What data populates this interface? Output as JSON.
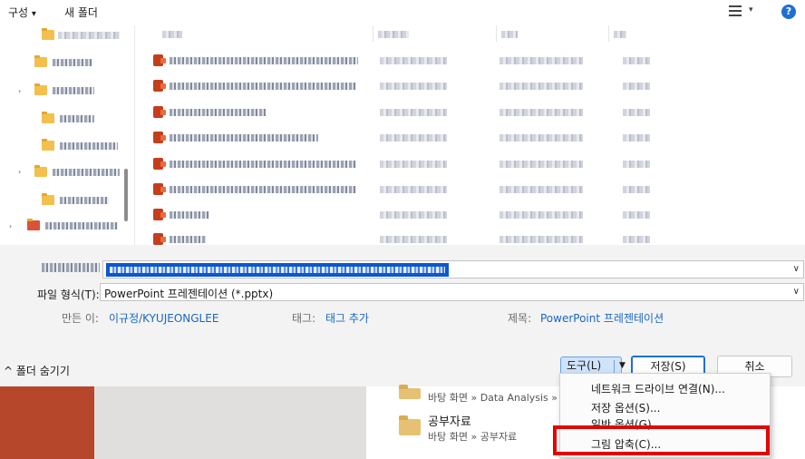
{
  "toolbar": {
    "organize_label": "구성",
    "organize_caret": "▾",
    "new_folder_label": "새 폴더",
    "view_caret": "▾",
    "help_label": "?"
  },
  "file_type": {
    "label": "파일 형식(T):",
    "value": "PowerPoint 프레젠테이션 (*.pptx)",
    "caret": "∨"
  },
  "filename": {
    "caret": "∨"
  },
  "meta": {
    "author_label": "만든 이:",
    "author_value": "이규정/KYUJEONGLEE",
    "tags_label": "태그:",
    "tags_value": "태그 추가",
    "title_label": "제목:",
    "title_value": "PowerPoint 프레젠테이션"
  },
  "bottom": {
    "hide_folders_label": "^  폴더 숨기기",
    "tools_label": "도구(L)",
    "tools_arrow": "▼",
    "save_label": "저장(S)",
    "cancel_label": "취소"
  },
  "tools_menu": {
    "items": [
      "네트워크 드라이브 연결(N)...",
      "저장 옵션(S)...",
      "일반 옵션(G)...",
      "그림 압축(C)..."
    ]
  },
  "background_app": {
    "recent1_path": "바탕 화면 » Data Analysis »",
    "recent2_title": "공부자료",
    "recent2_path": "바탕 화면 » 공부자료"
  },
  "colors": {
    "accent": "#1f6fd1",
    "link": "#1a66c6",
    "highlight_box": "#e60000",
    "selection": "#0a58d0",
    "powerpoint": "#b7472a"
  }
}
